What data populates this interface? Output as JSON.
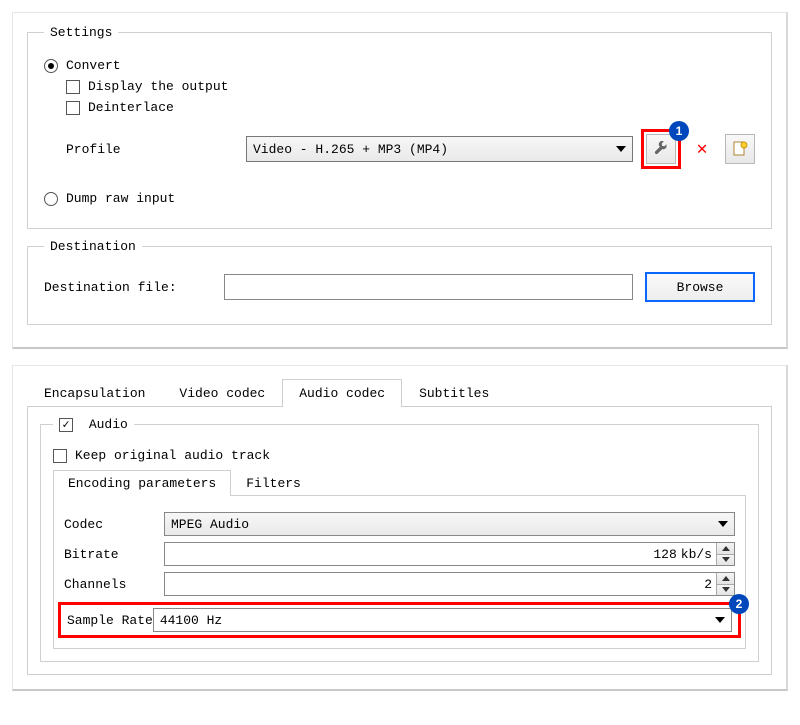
{
  "top": {
    "settings_legend": "Settings",
    "convert_label": "Convert",
    "display_output_label": "Display the output",
    "deinterlace_label": "Deinterlace",
    "profile_label": "Profile",
    "profile_value": "Video - H.265 + MP3 (MP4)",
    "dump_raw_label": "Dump raw input",
    "annotations": {
      "wrench_badge": "1"
    }
  },
  "destination": {
    "legend": "Destination",
    "file_label": "Destination file:",
    "file_value": "",
    "browse_label": "Browse"
  },
  "tabs": {
    "encapsulation": "Encapsulation",
    "video_codec": "Video codec",
    "audio_codec": "Audio codec",
    "subtitles": "Subtitles"
  },
  "audio_group": {
    "audio_legend": "Audio",
    "keep_original_label": "Keep original audio track"
  },
  "subtabs": {
    "encoding_params": "Encoding parameters",
    "filters": "Filters"
  },
  "encoding": {
    "codec_label": "Codec",
    "codec_value": "MPEG Audio",
    "bitrate_label": "Bitrate",
    "bitrate_value": "128",
    "bitrate_unit": "kb/s",
    "channels_label": "Channels",
    "channels_value": "2",
    "sample_rate_label": "Sample Rate",
    "sample_rate_value": "44100 Hz",
    "sample_rate_badge": "2"
  }
}
